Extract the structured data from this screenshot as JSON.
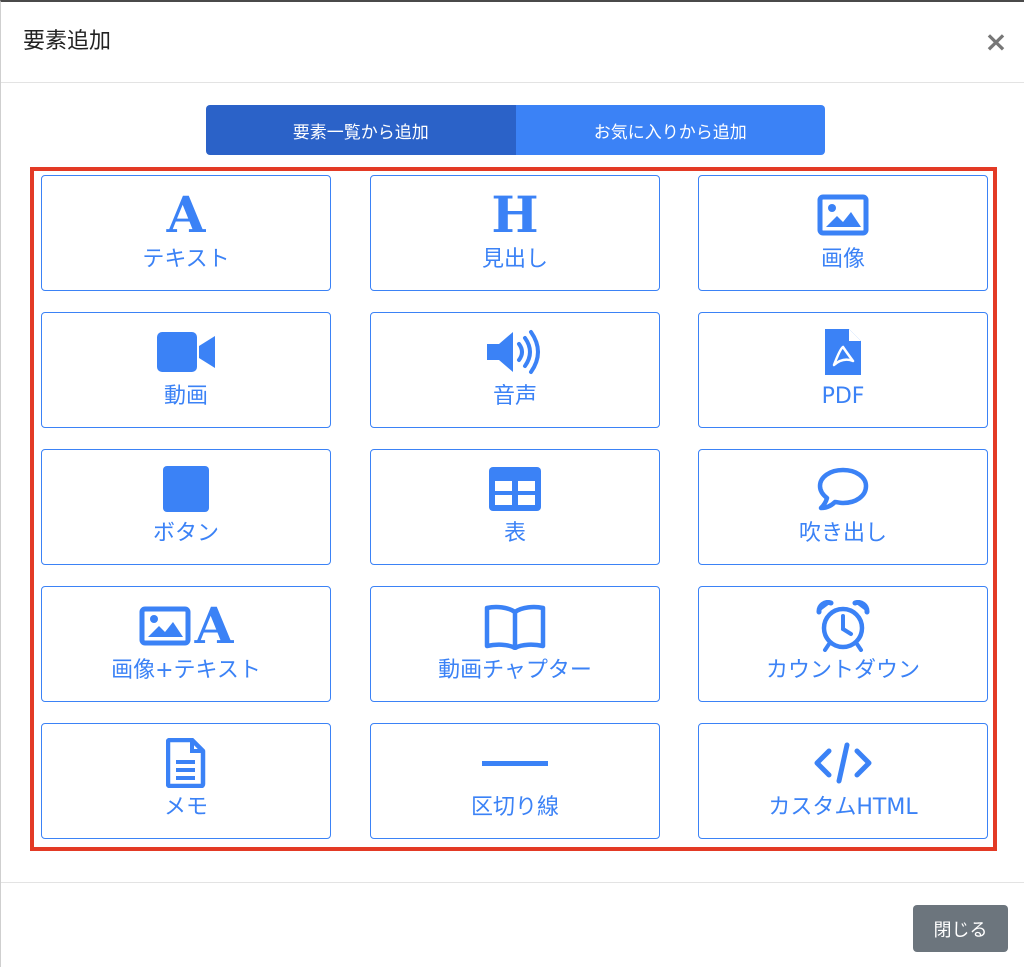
{
  "modal": {
    "title": "要素追加",
    "close_glyph": "×"
  },
  "tabs": [
    {
      "label": "要素一覧から追加",
      "active": true
    },
    {
      "label": "お気に入りから追加",
      "active": false
    }
  ],
  "elements": [
    {
      "label": "テキスト",
      "icon": "text-a-icon"
    },
    {
      "label": "見出し",
      "icon": "heading-h-icon"
    },
    {
      "label": "画像",
      "icon": "image-icon"
    },
    {
      "label": "動画",
      "icon": "video-camera-icon"
    },
    {
      "label": "音声",
      "icon": "speaker-icon"
    },
    {
      "label": "PDF",
      "icon": "pdf-file-icon"
    },
    {
      "label": "ボタン",
      "icon": "square-button-icon"
    },
    {
      "label": "表",
      "icon": "table-icon"
    },
    {
      "label": "吹き出し",
      "icon": "speech-bubble-icon"
    },
    {
      "label": "画像+テキスト",
      "icon": "image-text-icon"
    },
    {
      "label": "動画チャプター",
      "icon": "book-icon"
    },
    {
      "label": "カウントダウン",
      "icon": "alarm-clock-icon"
    },
    {
      "label": "メモ",
      "icon": "document-icon"
    },
    {
      "label": "区切り線",
      "icon": "divider-line-icon"
    },
    {
      "label": "カスタムHTML",
      "icon": "code-icon"
    }
  ],
  "footer": {
    "close_label": "閉じる"
  },
  "colors": {
    "accent": "#3b82f6",
    "tab_active": "#2b62c8",
    "highlight_border": "#e33a25",
    "secondary_button": "#6c757d"
  },
  "icon_glyphs": {
    "text": "A",
    "heading": "H"
  }
}
